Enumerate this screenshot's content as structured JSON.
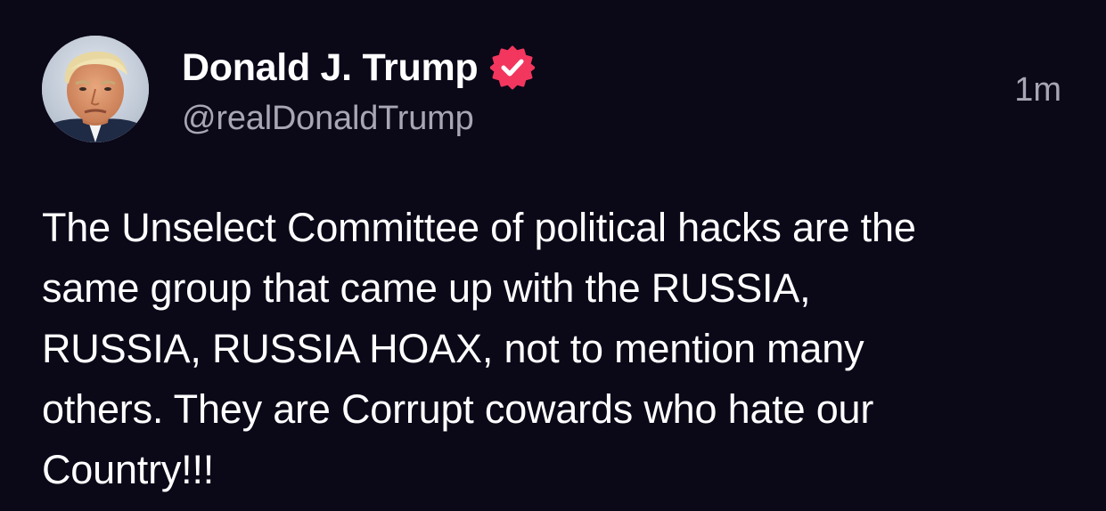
{
  "author": {
    "display_name": "Donald J. Trump",
    "handle": "@realDonaldTrump",
    "verified": true,
    "verified_icon": "verified-badge-icon",
    "verified_color": "#f2365e"
  },
  "post": {
    "timestamp": "1m",
    "lines": [
      "The Unselect Committee of political hacks are the",
      "same group that came up with the RUSSIA,",
      "RUSSIA, RUSSIA HOAX, not to mention many",
      "others. They are Corrupt cowards who hate our",
      "Country!!!"
    ]
  },
  "colors": {
    "background": "#0b0818",
    "primary_text": "#ffffff",
    "secondary_text": "#a8a6b4"
  }
}
